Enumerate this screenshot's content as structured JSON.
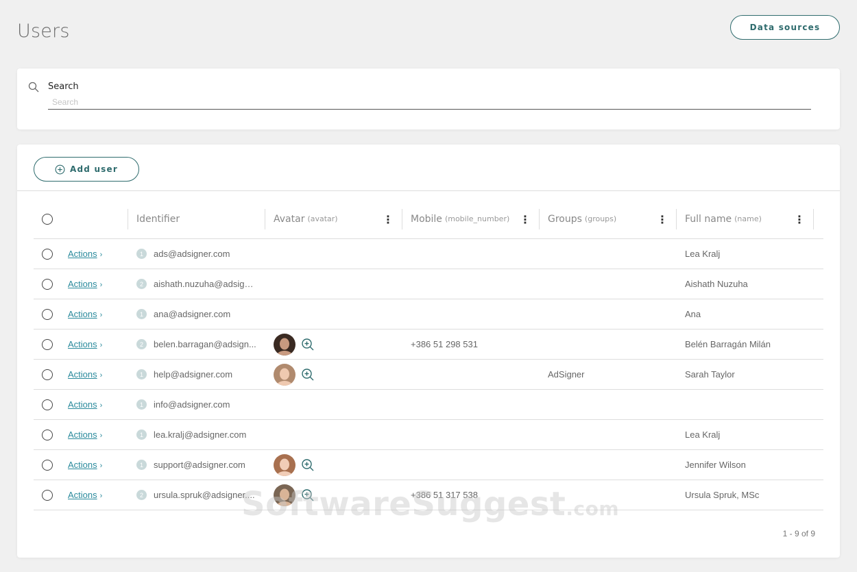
{
  "page": {
    "title": "Users"
  },
  "header": {
    "data_sources_label": "Data sources"
  },
  "search": {
    "label": "Search",
    "placeholder": "Search",
    "value": ""
  },
  "toolbar": {
    "add_user_label": "Add user"
  },
  "table": {
    "columns": [
      {
        "title": "Identifier",
        "sub": ""
      },
      {
        "title": "Avatar",
        "sub": "(avatar)"
      },
      {
        "title": "Mobile",
        "sub": "(mobile_number)"
      },
      {
        "title": "Groups",
        "sub": "(groups)"
      },
      {
        "title": "Full name",
        "sub": "(name)"
      }
    ],
    "rows": [
      {
        "actions": "Actions",
        "count": "1",
        "identifier": "ads@adsigner.com",
        "avatar": false,
        "mobile": "",
        "groups": "",
        "name": "Lea Kralj"
      },
      {
        "actions": "Actions",
        "count": "2",
        "identifier": "aishath.nuzuha@adsign...",
        "avatar": false,
        "mobile": "",
        "groups": "",
        "name": "Aishath Nuzuha"
      },
      {
        "actions": "Actions",
        "count": "1",
        "identifier": "ana@adsigner.com",
        "avatar": false,
        "mobile": "",
        "groups": "",
        "name": "Ana"
      },
      {
        "actions": "Actions",
        "count": "2",
        "identifier": "belen.barragan@adsign...",
        "avatar": true,
        "mobile": "+386 51 298 531",
        "groups": "",
        "name": "Belén Barragán Milán"
      },
      {
        "actions": "Actions",
        "count": "1",
        "identifier": "help@adsigner.com",
        "avatar": true,
        "mobile": "",
        "groups": "AdSigner",
        "name": "Sarah Taylor"
      },
      {
        "actions": "Actions",
        "count": "1",
        "identifier": "info@adsigner.com",
        "avatar": false,
        "mobile": "",
        "groups": "",
        "name": ""
      },
      {
        "actions": "Actions",
        "count": "1",
        "identifier": "lea.kralj@adsigner.com",
        "avatar": false,
        "mobile": "",
        "groups": "",
        "name": "Lea Kralj"
      },
      {
        "actions": "Actions",
        "count": "1",
        "identifier": "support@adsigner.com",
        "avatar": true,
        "mobile": "",
        "groups": "",
        "name": "Jennifer Wilson"
      },
      {
        "actions": "Actions",
        "count": "2",
        "identifier": "ursula.spruk@adsigner....",
        "avatar": true,
        "mobile": "+386 51 317 538",
        "groups": "",
        "name": "Ursula Spruk, MSc"
      }
    ]
  },
  "pagination": {
    "summary": "1 - 9 of 9"
  },
  "watermark": {
    "text": "SoftwareSuggest",
    "suffix": ".com"
  },
  "colors": {
    "accent": "#2e6b6d",
    "link": "#2a8a9c",
    "background": "#f0f0f0"
  },
  "icons": {
    "search": "search-icon",
    "add": "plus-circle-icon",
    "column_menu": "kebab-menu-icon",
    "zoom": "zoom-in-icon",
    "chevron": "chevron-right-icon"
  }
}
